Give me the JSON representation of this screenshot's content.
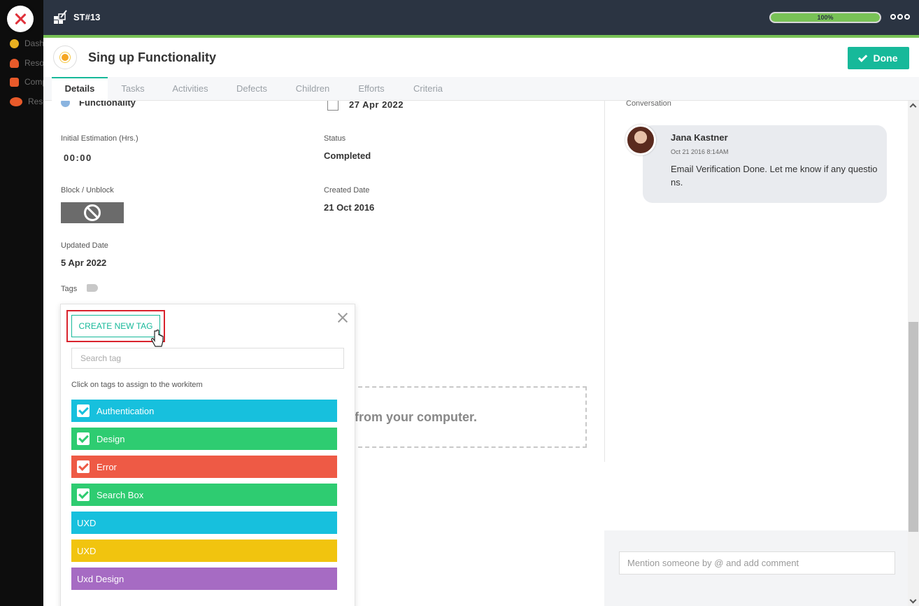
{
  "leftnav": {
    "items": [
      {
        "label": "Dashboard",
        "color": "#e8b020"
      },
      {
        "label": "Resources",
        "color": "#e85a2a"
      },
      {
        "label": "Company",
        "color": "#e85a2a"
      },
      {
        "label": "Resources",
        "color": "#e85a2a"
      }
    ]
  },
  "topbar": {
    "id": "ST#13",
    "progress": 100,
    "progress_label": "100%"
  },
  "header": {
    "title": "Sing up Functionality",
    "done_label": "Done"
  },
  "tabs": [
    "Details",
    "Tasks",
    "Activities",
    "Defects",
    "Children",
    "Efforts",
    "Criteria"
  ],
  "details": {
    "category_value": "Functionality",
    "due_date": "27 Apr 2022",
    "estimation_label": "Initial Estimation (Hrs.)",
    "estimation_value": "00:00",
    "status_label": "Status",
    "status_value": "Completed",
    "block_label": "Block / Unblock",
    "created_label": "Created Date",
    "created_value": "21 Oct 2016",
    "updated_label": "Updated Date",
    "updated_value": "5 Apr 2022",
    "tags_label": "Tags",
    "dropzone_text": "t from your computer."
  },
  "tag_popup": {
    "create_label": "CREATE NEW TAG",
    "search_placeholder": "Search tag",
    "hint": "Click on tags to assign to the workitem",
    "tags": [
      {
        "label": "Authentication",
        "color": "#17c0dd",
        "checked": true
      },
      {
        "label": "Design",
        "color": "#2ecc71",
        "checked": true
      },
      {
        "label": "Error",
        "color": "#ee5a45",
        "checked": true
      },
      {
        "label": "Search Box",
        "color": "#2ecc71",
        "checked": true
      },
      {
        "label": "UXD",
        "color": "#17c0dd",
        "checked": false
      },
      {
        "label": "UXD",
        "color": "#f1c40f",
        "checked": false
      },
      {
        "label": "Uxd Design",
        "color": "#a66bc3",
        "checked": false
      }
    ]
  },
  "conversation": {
    "label": "Conversation",
    "messages": [
      {
        "author": "Jana Kastner",
        "time": "Oct 21 2016 8:14AM",
        "text": "Email Verification Done. Let me know if any questions."
      }
    ],
    "comment_placeholder": "Mention someone by @ and add comment"
  },
  "colors": {
    "accent": "#17b99a",
    "topbar": "#2b3442",
    "progress": "#78c256"
  }
}
